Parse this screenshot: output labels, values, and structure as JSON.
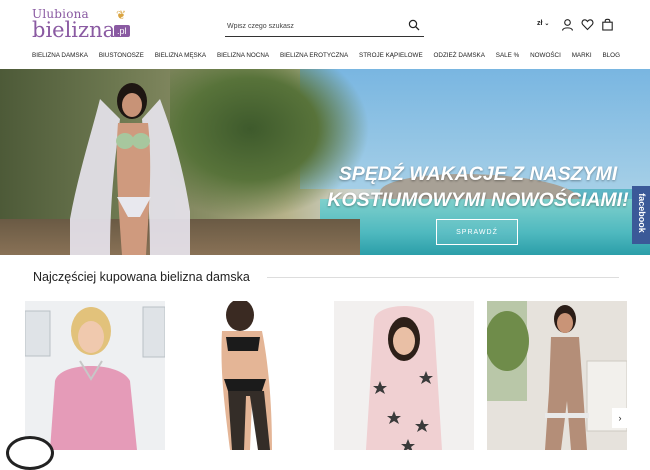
{
  "header": {
    "logo_top": "Ulubiona",
    "logo_main": "bielizna",
    "logo_tld": ".pl",
    "search_placeholder": "Wpisz czego szukasz",
    "currency": "zł",
    "icons": [
      "search-icon",
      "user-icon",
      "heart-icon",
      "bag-icon"
    ]
  },
  "nav": [
    "BIELIZNA DAMSKA",
    "BIUSTONOSZE",
    "BIELIZNA MĘSKA",
    "BIELIZNA NOCNA",
    "BIELIZNA EROTYCZNA",
    "STROJE KĄPIELOWE",
    "ODZIEŻ DAMSKA",
    "SALE %",
    "NOWOŚCI",
    "MARKI",
    "BLOG"
  ],
  "banner": {
    "line1": "SPĘDŹ WAKACJE Z NASZYMI",
    "line2": "KOSTIUMOWYMI NOWOŚCIAMI!",
    "cta": "SPRAWDŹ",
    "side_tab": "facebook"
  },
  "section": {
    "title": "Najczęściej kupowana bielizna damska"
  },
  "colors": {
    "brand": "#8a5aa2",
    "facebook": "#3b5998"
  }
}
